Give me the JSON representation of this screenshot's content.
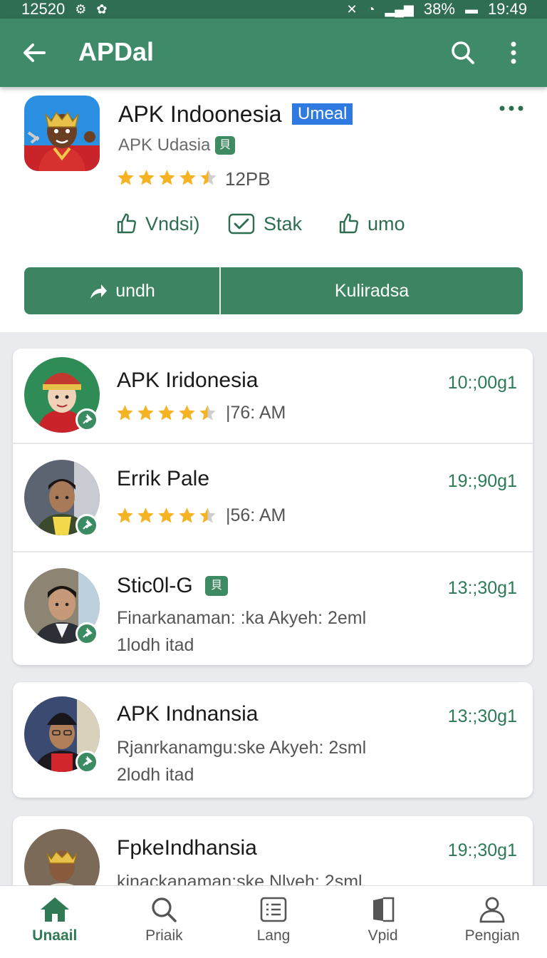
{
  "status_bar": {
    "left_text": "12520",
    "battery": "38%",
    "time": "19:49"
  },
  "app_bar": {
    "title": "APDal"
  },
  "app_header": {
    "name": "APK Indoonesia",
    "badge": "Umeal",
    "developer": "APK Udasia",
    "dev_badge": "⾙",
    "rating": 4.5,
    "size": "12PB",
    "actions": [
      {
        "label": "Vndsi)",
        "icon": "thumbs-up-icon"
      },
      {
        "label": "Stak",
        "icon": "check-mail-icon"
      },
      {
        "label": "umo",
        "icon": "thumbs-up-icon"
      }
    ],
    "button_left": "undh",
    "button_right": "Kuliradsa"
  },
  "list": [
    {
      "title": "APK Iridonesia",
      "time": "10:;00g1",
      "rating": 4.5,
      "meta": "|76: AM"
    },
    {
      "title": "Errik Pale",
      "time": "19:;90g1",
      "rating": 4.5,
      "meta": "|56: AM"
    },
    {
      "title": "Stic0l-G",
      "time": "13:;30g1",
      "badge": "⾙",
      "sub1": "Finarkanaman: :ka Akyeh: 2eml",
      "sub2": "1lodh itad"
    },
    {
      "title": "APK Indnansia",
      "time": "13:;30g1",
      "sub1": "Rjanrkanamgu:ske Akyeh: 2sml",
      "sub2": "2lodh itad"
    },
    {
      "title": "FpkeIndhansia",
      "time": "19:;30g1",
      "sub1": "kinackanaman:ske Nlveh: 2sml"
    }
  ],
  "bottom_nav": [
    {
      "label": "Unaail",
      "icon": "home-icon",
      "active": true
    },
    {
      "label": "Priaik",
      "icon": "search-icon",
      "active": false
    },
    {
      "label": "Lang",
      "icon": "list-icon",
      "active": false
    },
    {
      "label": "Vpid",
      "icon": "book-icon",
      "active": false
    },
    {
      "label": "Pengian",
      "icon": "person-icon",
      "active": false
    }
  ],
  "colors": {
    "primary": "#3f8a68",
    "status_bar": "#2f6e52",
    "accent_text": "#2d7a56",
    "star": "#f5b323",
    "badge_blue": "#2f7ae0"
  }
}
